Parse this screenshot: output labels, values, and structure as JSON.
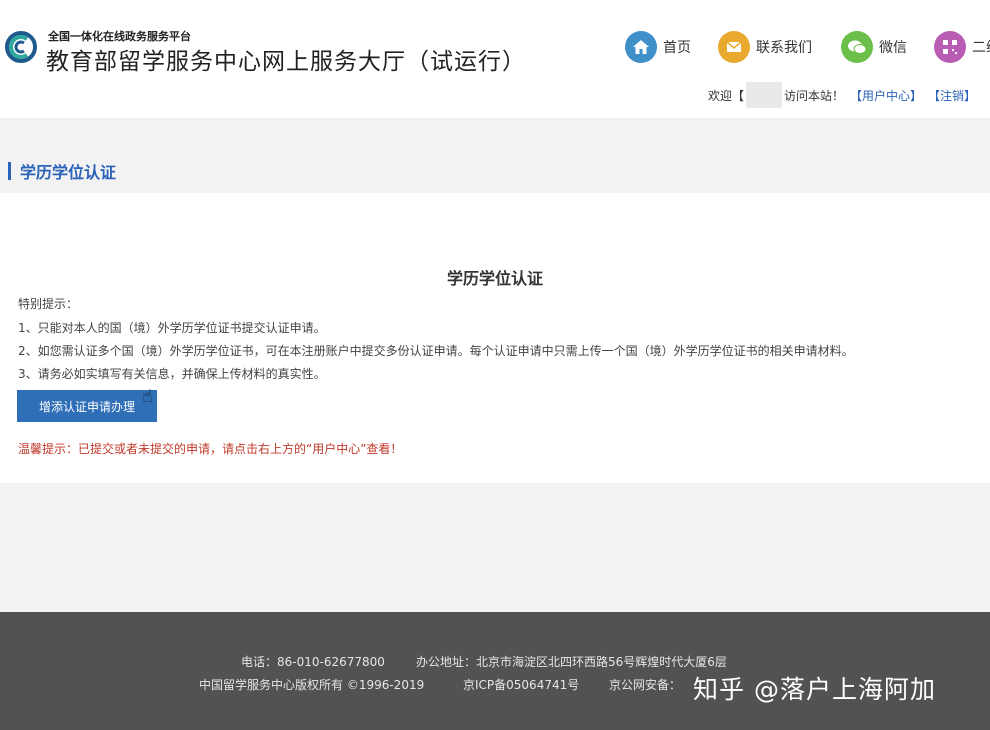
{
  "header": {
    "subtitle": "全国一体化在线政务服务平台",
    "title": "教育部留学服务中心网上服务大厅（试运行）",
    "nav": {
      "home": "首页",
      "contact": "联系我们",
      "wechat": "微信",
      "qrcode": "二维"
    },
    "welcome": {
      "prefix": "欢迎【",
      "suffix": "访问本站！",
      "user_center": "【用户中心】",
      "logout": "【注销】"
    }
  },
  "section": {
    "title": "学历学位认证"
  },
  "content": {
    "title": "学历学位认证",
    "tip_label": "特别提示：",
    "tips": [
      "1、只能对本人的国（境）外学历学位证书提交认证申请。",
      "2、如您需认证多个国（境）外学历学位证书，可在本注册账户中提交多份认证申请。每个认证申请中只需上传一个国（境）外学历学位证书的相关申请材料。",
      "3、请务必如实填写有关信息，并确保上传材料的真实性。"
    ],
    "apply_button": "增添认证申请办理",
    "warm_tip": "温馨提示：已提交或者未提交的申请，请点击右上方的“用户中心”查看！"
  },
  "footer": {
    "phone": "电话：86-010-62677800",
    "address": "办公地址：北京市海淀区北四环西路56号辉煌时代大厦6层",
    "copyright": "中国留学服务中心版权所有 ©1996-2019",
    "icp": "京ICP备05064741号",
    "police": "京公网安备："
  },
  "watermark": "知乎 @落户上海阿加",
  "colors": {
    "accent": "#2a62b8",
    "button": "#2f6fb8",
    "warning": "#c0392b",
    "footer_bg": "#525252",
    "band_bg": "#f2f2f2"
  },
  "icons": [
    "logo-icon",
    "home-icon",
    "mail-icon",
    "wechat-icon",
    "qrcode-icon",
    "hand-cursor-icon"
  ]
}
